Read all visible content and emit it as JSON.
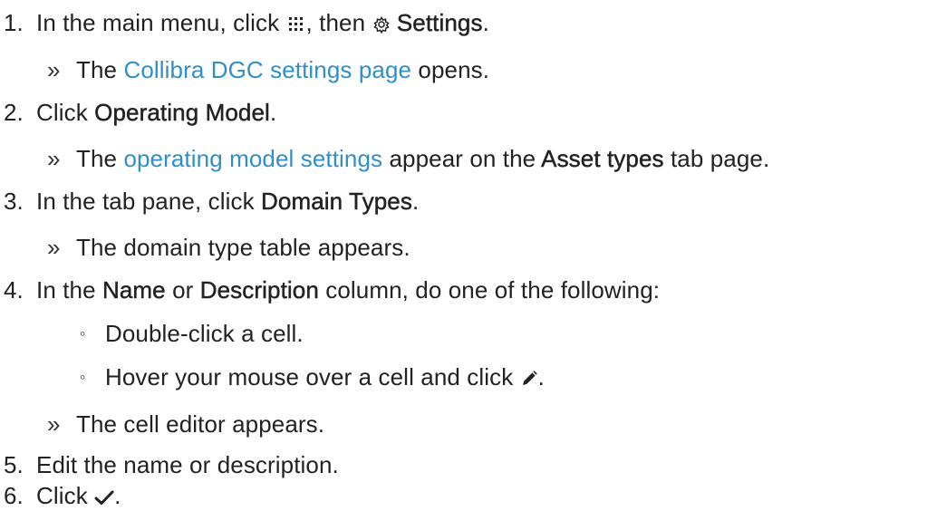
{
  "steps": [
    {
      "number": "1.",
      "text_1": "In the main menu, click",
      "icon_1": "apps-grid-icon",
      "text_2": ", then",
      "icon_2": "gear-icon",
      "bold_1": "Settings",
      "text_3": ".",
      "result": {
        "marker": "»",
        "prefix": "The",
        "link": "Collibra DGC settings page",
        "suffix": "opens."
      }
    },
    {
      "number": "2.",
      "text_1": "Click",
      "bold_1": "Operating Model",
      "text_2": ".",
      "result": {
        "marker": "»",
        "prefix": "The",
        "link": "operating model settings",
        "middle": "appear on the",
        "bold": "Asset types",
        "suffix": "tab page."
      }
    },
    {
      "number": "3.",
      "text_1": "In the tab pane, click",
      "bold_1": "Domain Types",
      "text_2": ".",
      "result": {
        "marker": "»",
        "text": "The domain type table appears."
      }
    },
    {
      "number": "4.",
      "text_1": "In the",
      "bold_1": "Name",
      "text_2": "or",
      "bold_2": "Description",
      "text_3": "column, do one of the following:",
      "options": [
        {
          "marker": "◦",
          "text": "Double-click a cell."
        },
        {
          "marker": "◦",
          "text": "Hover your mouse over a cell and click",
          "icon": "pencil-icon",
          "after": "."
        }
      ],
      "result": {
        "marker": "»",
        "text": "The cell editor appears."
      }
    },
    {
      "number": "5.",
      "text_1": "Edit the name or description."
    },
    {
      "number": "6.",
      "text_1": "Click",
      "icon_1": "checkmark-icon",
      "text_2": "."
    }
  ],
  "colors": {
    "text": "#222222",
    "link": "#2f8fc6"
  }
}
